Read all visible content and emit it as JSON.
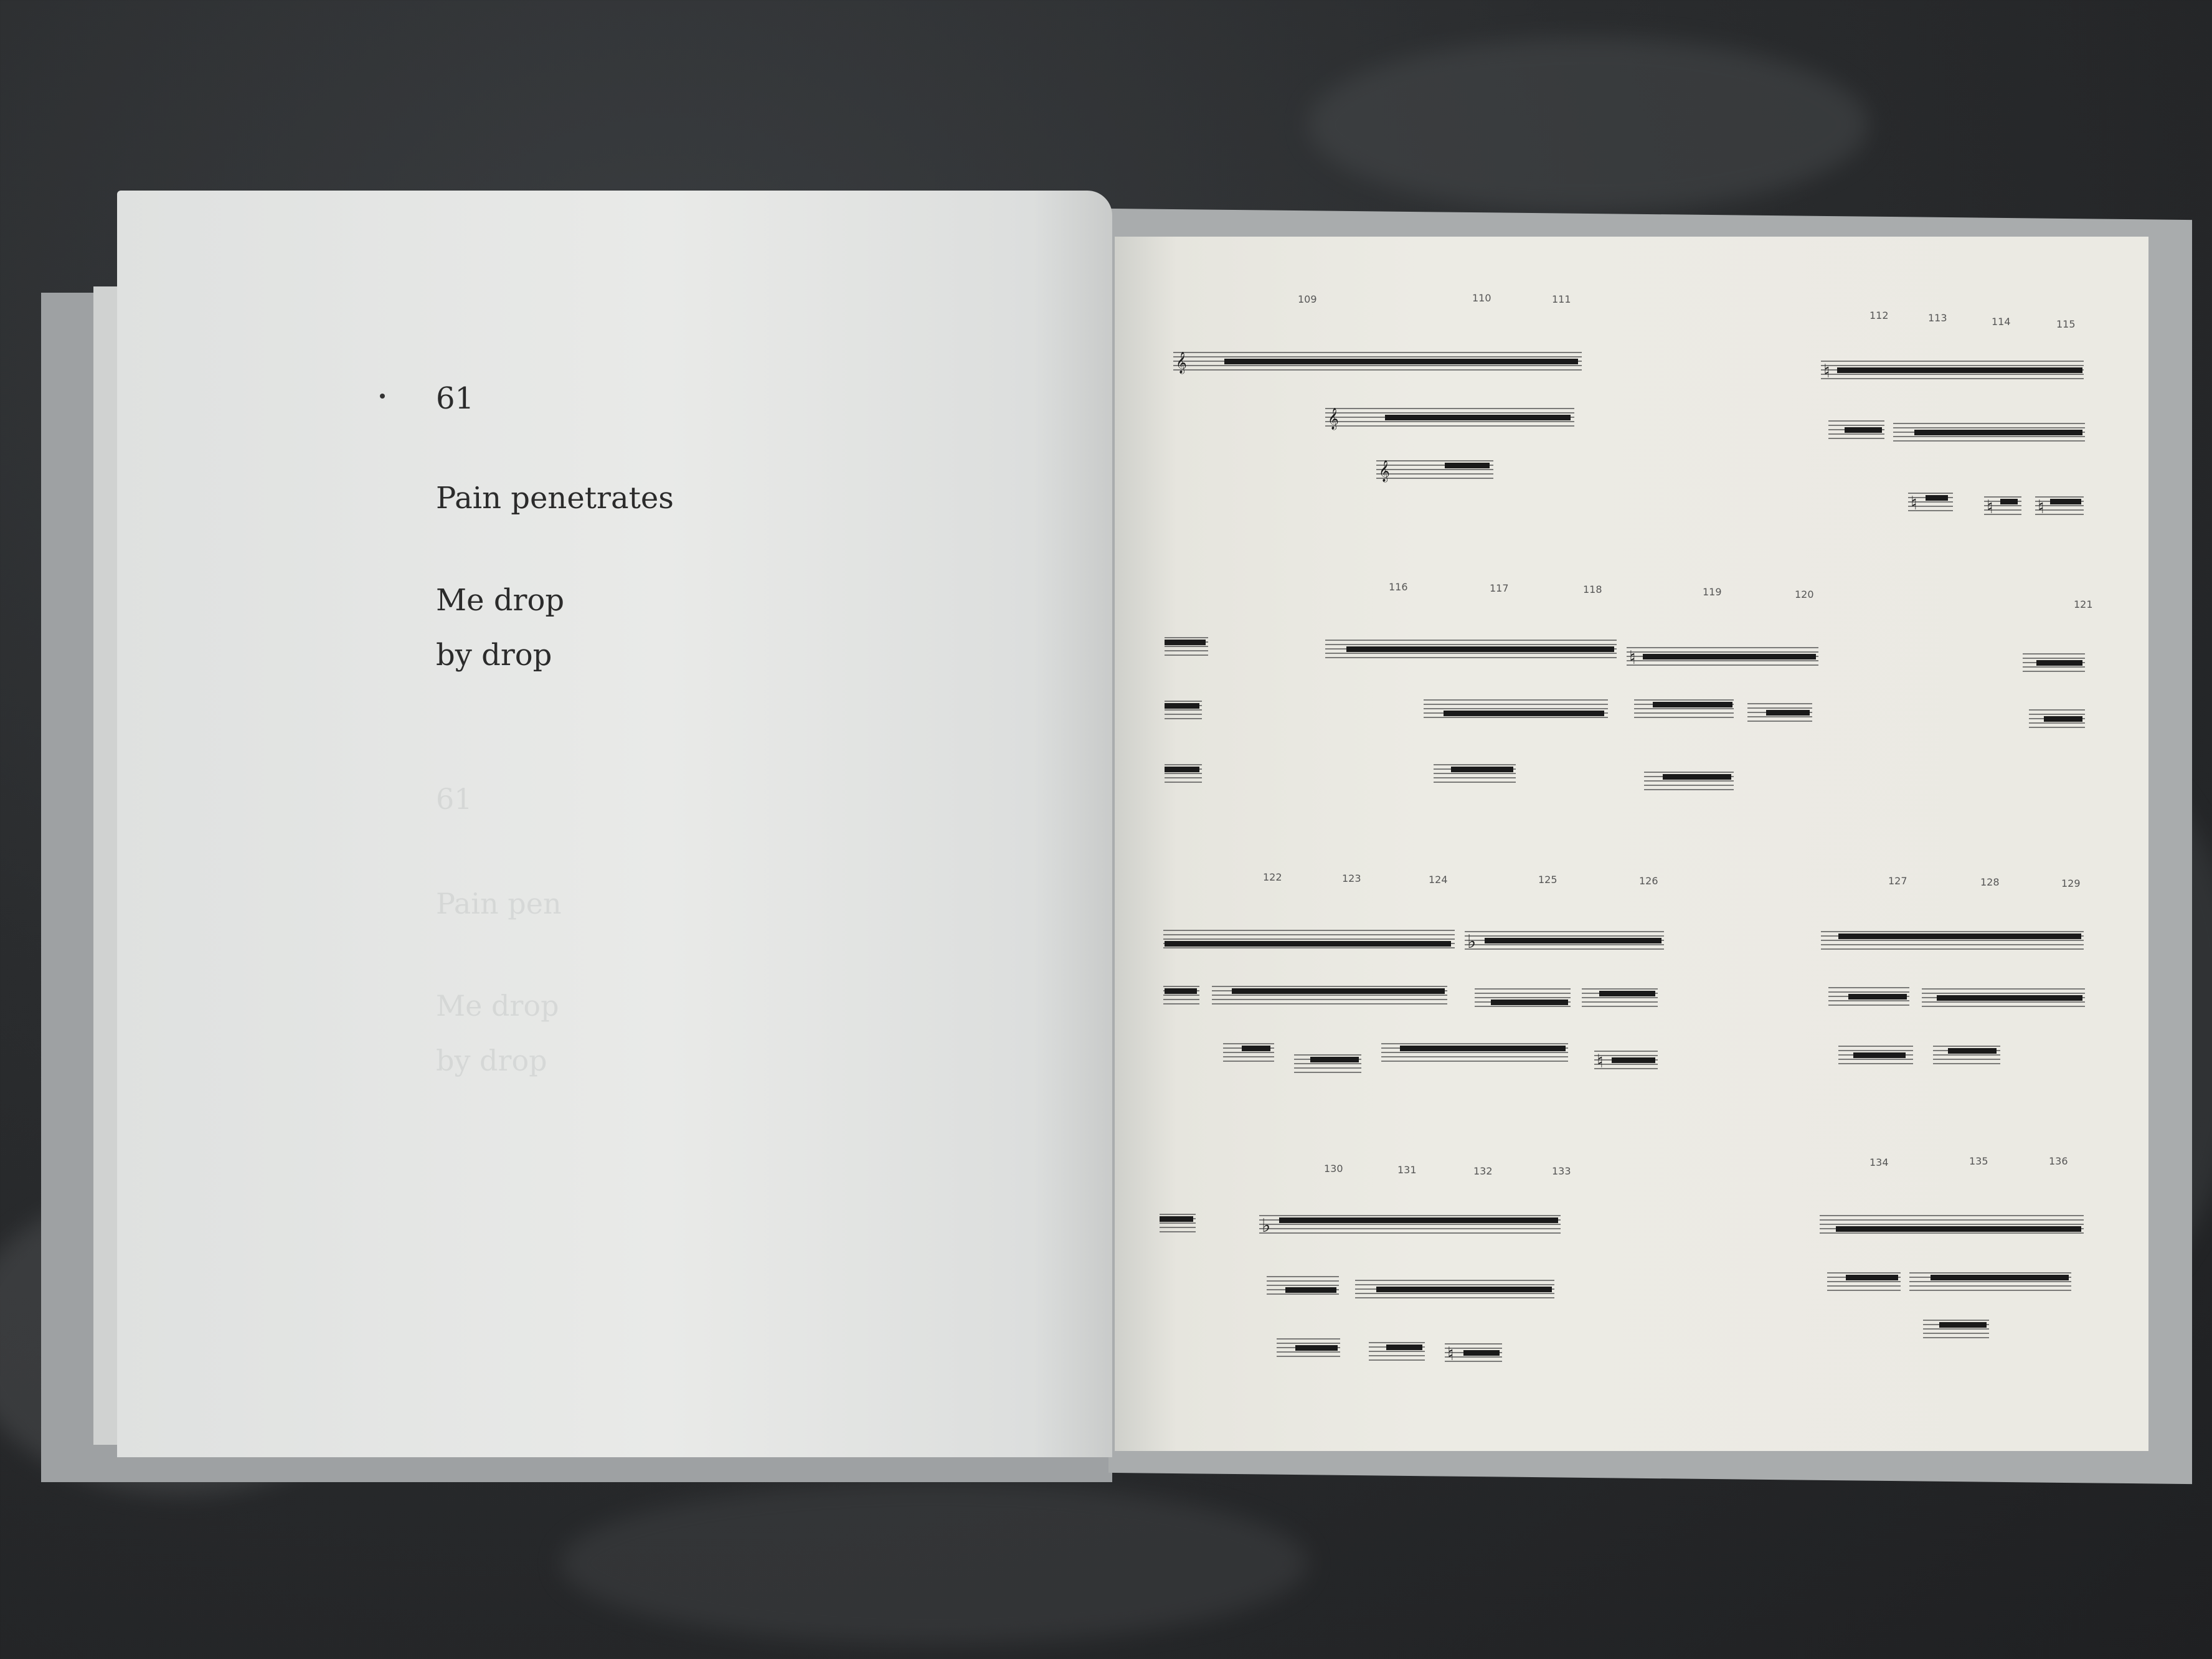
{
  "left_page": {
    "number": "61",
    "title": "Pain penetrates",
    "line_a": "Me drop",
    "line_b": "by drop",
    "ghost_number": "61",
    "ghost_title": "Pain pen",
    "ghost_a": "Me drop",
    "ghost_b": "by drop"
  },
  "right_page": {
    "measure_numbers": [
      "109",
      "110",
      "111",
      "112",
      "113",
      "114",
      "115",
      "116",
      "117",
      "118",
      "119",
      "120",
      "121",
      "122",
      "123",
      "124",
      "125",
      "126",
      "127",
      "128",
      "129",
      "130",
      "131",
      "132",
      "133",
      "134",
      "135",
      "136"
    ]
  },
  "colors": {
    "background": "#2a2c2e",
    "cover": "#a6a9ab",
    "left_paper": "#e6e7e5",
    "right_paper": "#ebeae3",
    "ink": "#1a1a1a"
  }
}
